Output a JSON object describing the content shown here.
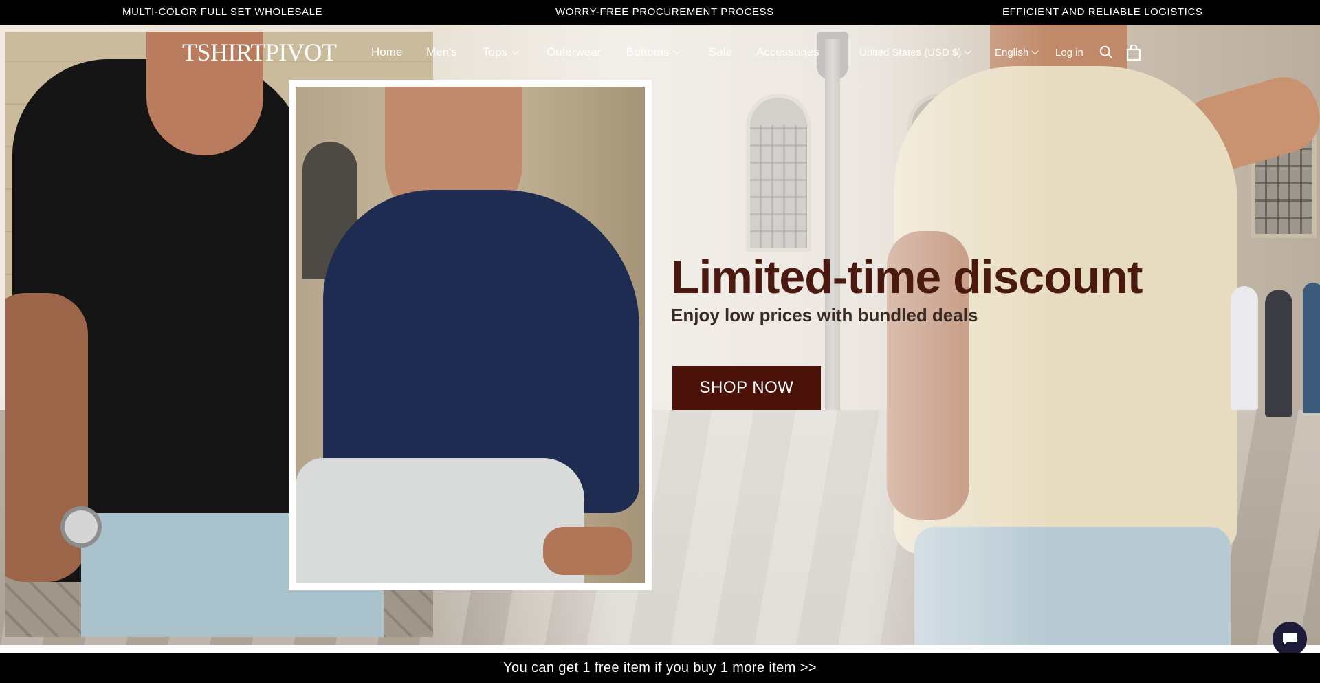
{
  "announcement": {
    "left": "MULTI-COLOR FULL SET WHOLESALE",
    "center": "WORRY-FREE PROCUREMENT PROCESS",
    "right": "EFFICIENT AND RELIABLE LOGISTICS"
  },
  "header": {
    "logo": "TSHIRTPIVOT",
    "nav": [
      {
        "label": "Home",
        "has_dropdown": false
      },
      {
        "label": "Men's",
        "has_dropdown": false
      },
      {
        "label": "Tops",
        "has_dropdown": true
      },
      {
        "label": "Outerwear",
        "has_dropdown": false
      },
      {
        "label": "Bottoms",
        "has_dropdown": true
      },
      {
        "label": "Sale",
        "has_dropdown": false
      },
      {
        "label": "Accessories",
        "has_dropdown": false
      }
    ],
    "country": "United States (USD $)",
    "language": "English",
    "login": "Log in",
    "icons": [
      "search-icon",
      "cart-icon"
    ]
  },
  "hero": {
    "title": "Limited-time discount",
    "subtitle": "Enjoy low prices with bundled deals",
    "cta": "SHOP NOW"
  },
  "bottom_bar": {
    "text": "You can get 1 free item if you buy 1 more item  >>"
  },
  "colors": {
    "announcement_bg": "#000000",
    "cta_bg": "#4a1208",
    "title_color": "#4a1a10",
    "chat_bg": "#1c1c3a"
  }
}
